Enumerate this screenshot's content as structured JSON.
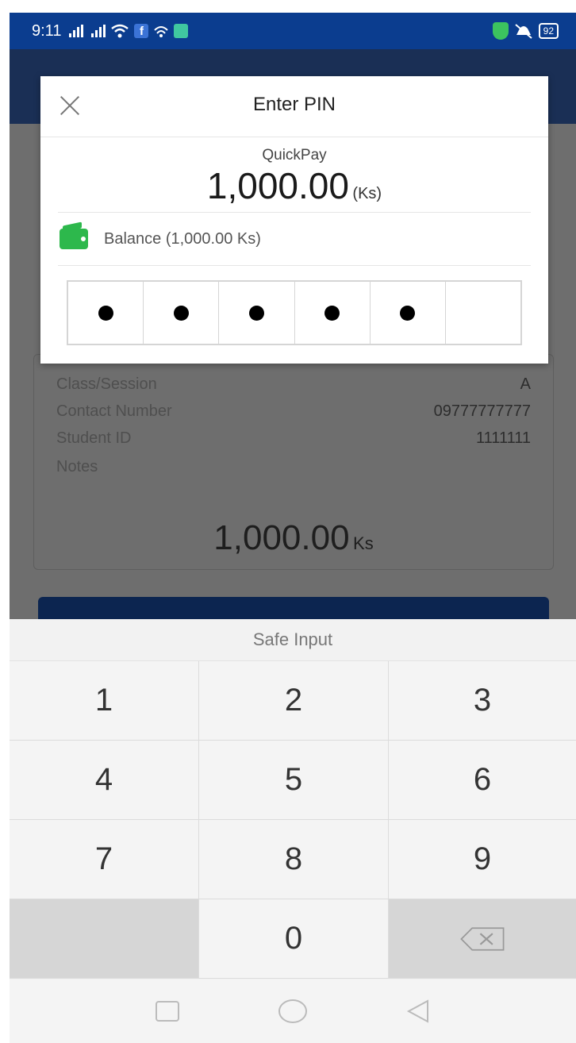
{
  "status_bar": {
    "time": "9:11",
    "battery": "92",
    "icons": [
      "signal-icon",
      "signal-icon",
      "wifi-icon",
      "facebook-icon",
      "hotspot-icon",
      "app-notification-icon",
      "shield-icon",
      "mute-icon",
      "battery-icon"
    ]
  },
  "background_details": {
    "rows": [
      {
        "label": "Class/Session",
        "value": "A"
      },
      {
        "label": "Contact Number",
        "value": "09777777777"
      },
      {
        "label": "Student ID",
        "value": "1111111"
      },
      {
        "label": "Notes",
        "value": ""
      }
    ],
    "amount": "1,000.00",
    "unit": "Ks"
  },
  "dialog": {
    "title": "Enter PIN",
    "merchant": "QuickPay",
    "amount": "1,000.00",
    "unit": "(Ks)",
    "balance": "Balance (1,000.00 Ks)",
    "pin_length": 6,
    "pin_filled": 5
  },
  "keyboard": {
    "title": "Safe Input",
    "keys": [
      "1",
      "2",
      "3",
      "4",
      "5",
      "6",
      "7",
      "8",
      "9",
      "",
      "0",
      "delete"
    ]
  },
  "colors": {
    "brand_blue": "#0b3d8f",
    "wallet_green": "#2db84c"
  }
}
